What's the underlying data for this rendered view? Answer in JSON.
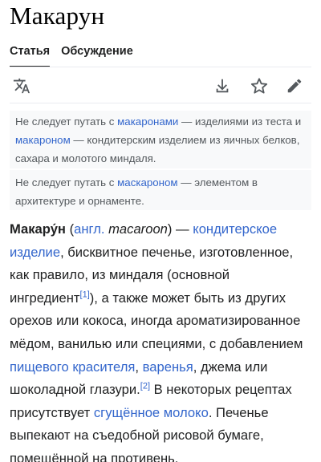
{
  "page": {
    "title": "Макарун"
  },
  "tabs": [
    {
      "label": "Статья"
    },
    {
      "label": "Обсуждение"
    }
  ],
  "toolbar": {
    "icons": [
      "language-icon",
      "download-icon",
      "star-icon",
      "edit-pencil-icon"
    ]
  },
  "hatnote1": {
    "t1": "Не следует путать с ",
    "link1": "макаронами",
    "t2": " — изделиями из теста и ",
    "link2": "макароном",
    "t3": " — кондитерским изделием из яичных белков, сахара и молотого миндаля."
  },
  "hatnote2": {
    "t1": "Не следует путать с ",
    "link1": "маскароном",
    "t2": " — элементом в архитектуре и орнаменте."
  },
  "article": {
    "term": "Макару́н",
    "p_open": " (",
    "lang_link": "англ.",
    "lang_space": " ",
    "foreign": "macaroon",
    "t1": ") — ",
    "link_confectionery": "кондитерское изделие",
    "t2": ", бисквитное печенье, изготовленное, как правило, из миндаля (основной ингредиент",
    "ref1": "[1]",
    "t3": "), а также может быть из других орехов или кокоса, иногда ароматизированное мёдом, ванилью или специями, с добавлением ",
    "link_dye": "пищевого красителя",
    "t4": ", ",
    "link_jam": "варенья",
    "t5": ", джема или шоколадной глазури.",
    "ref2": "[2]",
    "t6": " В некоторых рецептах присутствует ",
    "link_milk": "сгущённое молоко",
    "t7": ". Печенье выпекают на съедобной рисовой бумаге, помещённой на противень."
  },
  "colors": {
    "link": "#3366cc",
    "text": "#202122",
    "hatnote_bg": "#f8f9fa",
    "hatnote_text": "#54595d"
  }
}
